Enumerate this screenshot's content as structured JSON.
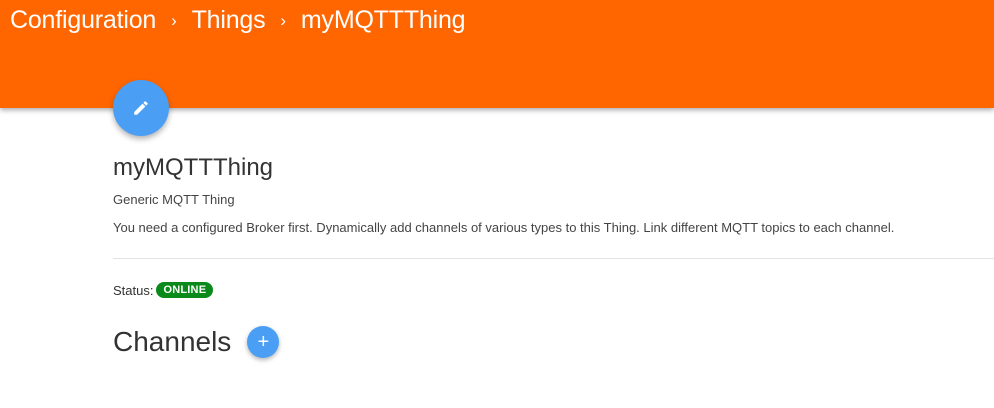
{
  "breadcrumb": {
    "items": [
      "Configuration",
      "Things",
      "myMQTTThing"
    ],
    "separator": "›"
  },
  "thing": {
    "title": "myMQTTThing",
    "type": "Generic MQTT Thing",
    "description": "You need a configured Broker first. Dynamically add channels of various types to this Thing. Link different MQTT topics to each channel."
  },
  "status": {
    "label": "Status:",
    "value": "ONLINE",
    "color": "#0a8a1a"
  },
  "channels": {
    "title": "Channels",
    "add_icon": "+"
  },
  "icons": {
    "edit": "pencil-icon",
    "add": "plus-icon"
  },
  "colors": {
    "header": "#ff6600",
    "fab": "#4a9ff5"
  }
}
